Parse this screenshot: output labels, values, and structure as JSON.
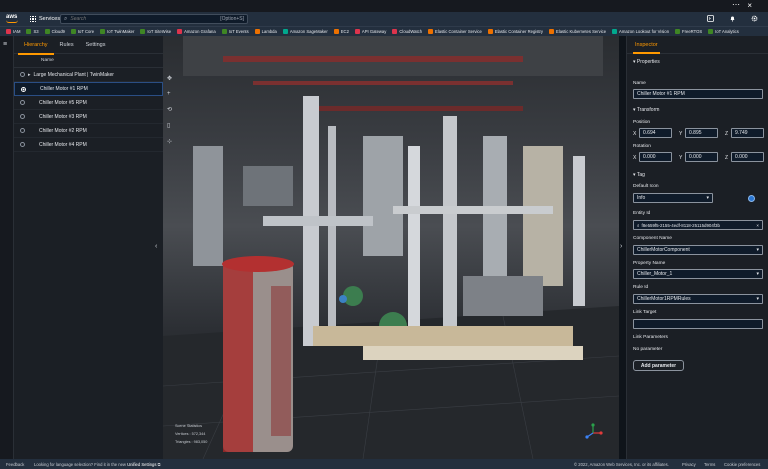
{
  "topbar": {
    "close_icon": "×",
    "more_icon": "⋯"
  },
  "servicebar": {
    "logo": "aws",
    "services_label": "Services",
    "search_placeholder": "Search",
    "search_shortcut": "[Option+S]"
  },
  "favorites": [
    {
      "label": "IAM",
      "color": "#dd344c"
    },
    {
      "label": "S3",
      "color": "#3f8624"
    },
    {
      "label": "Cloud9",
      "color": "#3f8624"
    },
    {
      "label": "IoT Core",
      "color": "#3f8624"
    },
    {
      "label": "IoT TwinMaker",
      "color": "#3f8624"
    },
    {
      "label": "IoT SiteWise",
      "color": "#3f8624"
    },
    {
      "label": "Amazon Grafana",
      "color": "#dd344c"
    },
    {
      "label": "IoT Events",
      "color": "#3f8624"
    },
    {
      "label": "Lambda",
      "color": "#ed7100"
    },
    {
      "label": "Amazon SageMaker",
      "color": "#01a88d"
    },
    {
      "label": "EC2",
      "color": "#ed7100"
    },
    {
      "label": "API Gateway",
      "color": "#dd344c"
    },
    {
      "label": "CloudWatch",
      "color": "#dd344c"
    },
    {
      "label": "Elastic Container Service",
      "color": "#ed7100"
    },
    {
      "label": "Elastic Container Registry",
      "color": "#ed7100"
    },
    {
      "label": "Elastic Kubernetes Service",
      "color": "#ed7100"
    },
    {
      "label": "Amazon Lookout for Vision",
      "color": "#01a88d"
    },
    {
      "label": "FreeRTOS",
      "color": "#3f8624"
    },
    {
      "label": "IoT Analytics",
      "color": "#3f8624"
    }
  ],
  "left_panel": {
    "tabs": [
      "Hierarchy",
      "Rules",
      "Settings"
    ],
    "column_header": "Name",
    "items": [
      {
        "label": "Large Mechanical Plant | TwinMaker",
        "selected": false
      },
      {
        "label": "Chiller Motor #1 RPM",
        "selected": true
      },
      {
        "label": "Chiller Motor #5 RPM",
        "selected": false
      },
      {
        "label": "Chiller Motor #3 RPM",
        "selected": false
      },
      {
        "label": "Chiller Motor #2 RPM",
        "selected": false
      },
      {
        "label": "Chiller Motor #4 RPM",
        "selected": false
      }
    ]
  },
  "viewport": {
    "stats_title": "Scene Statistics",
    "vertices": "Vertices : 572,344",
    "triangles": "Triangles : 983,050"
  },
  "inspector": {
    "tab": "Inspector",
    "properties_header": "Properties",
    "name_label": "Name",
    "name_value": "Chiller Motor #1 RPM",
    "transform_header": "Transform",
    "position_label": "Position",
    "position": {
      "x": "0.694",
      "y": "0.895",
      "z": "9.749"
    },
    "rotation_label": "Rotation",
    "rotation": {
      "x": "0.000",
      "y": "0.000",
      "z": "0.000"
    },
    "tag_header": "Tag",
    "default_icon_label": "Default Icon",
    "default_icon_value": "Info",
    "entity_id_label": "Entity Id",
    "entity_id_value": "f8e559f5-2155-4edf-8118-25115d904f3b",
    "component_name_label": "Component Name",
    "component_name_value": "ChillerMotorComponent",
    "property_name_label": "Property Name",
    "property_name_value": "Chiller_Motor_1",
    "rule_id_label": "Rule Id",
    "rule_id_value": "ChillerMotor1RPMRules",
    "link_target_label": "Link Target",
    "link_target_value": "",
    "link_params_label": "Link Parameters",
    "no_parameter": "No parameter",
    "add_parameter": "Add parameter"
  },
  "footer": {
    "feedback": "Feedback",
    "language_note": "Looking for language selection? Find it in the new",
    "unified_settings": "Unified Settings",
    "copyright": "© 2022, Amazon Web Services, Inc. or its affiliates.",
    "privacy": "Privacy",
    "terms": "Terms",
    "cookies": "Cookie preferences"
  }
}
